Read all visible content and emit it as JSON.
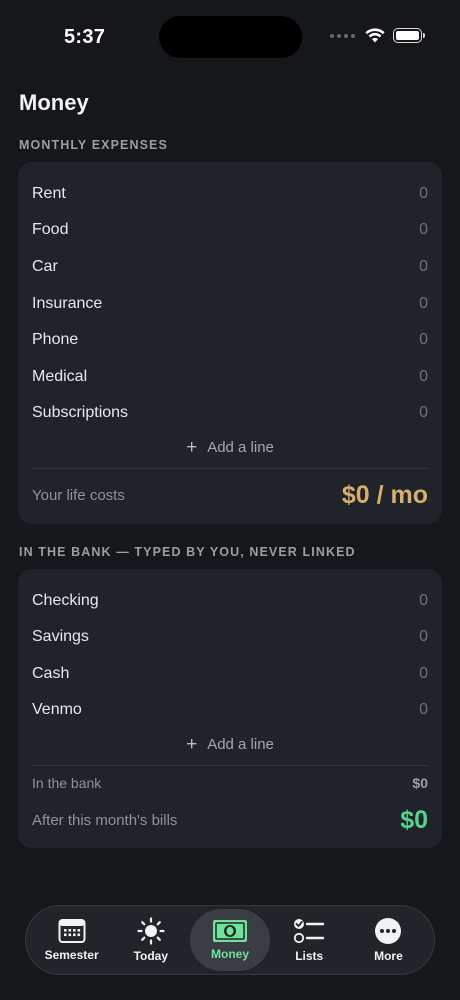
{
  "status": {
    "time": "5:37"
  },
  "page": {
    "title": "Money"
  },
  "expenses": {
    "header": "MONTHLY EXPENSES",
    "rows": [
      {
        "label": "Rent",
        "value": "0"
      },
      {
        "label": "Food",
        "value": "0"
      },
      {
        "label": "Car",
        "value": "0"
      },
      {
        "label": "Insurance",
        "value": "0"
      },
      {
        "label": "Phone",
        "value": "0"
      },
      {
        "label": "Medical",
        "value": "0"
      },
      {
        "label": "Subscriptions",
        "value": "0"
      }
    ],
    "add_line": "Add a line",
    "total_label": "Your life costs",
    "total_value": "$0 / mo"
  },
  "bank": {
    "header": "IN THE BANK — TYPED BY YOU, NEVER LINKED",
    "rows": [
      {
        "label": "Checking",
        "value": "0"
      },
      {
        "label": "Savings",
        "value": "0"
      },
      {
        "label": "Cash",
        "value": "0"
      },
      {
        "label": "Venmo",
        "value": "0"
      }
    ],
    "add_line": "Add a line",
    "in_bank_label": "In the bank",
    "in_bank_value": "$0",
    "after_bills_label": "After this month's bills",
    "after_bills_value": "$0"
  },
  "tabs": [
    {
      "label": "Semester",
      "icon": "calendar-icon"
    },
    {
      "label": "Today",
      "icon": "sun-icon"
    },
    {
      "label": "Money",
      "icon": "banknote-icon",
      "active": true
    },
    {
      "label": "Lists",
      "icon": "checklist-icon"
    },
    {
      "label": "More",
      "icon": "more-icon"
    }
  ],
  "colors": {
    "accent_gold": "#d9ad6a",
    "accent_green": "#55d28c",
    "active_tab": "#6fe29c"
  }
}
